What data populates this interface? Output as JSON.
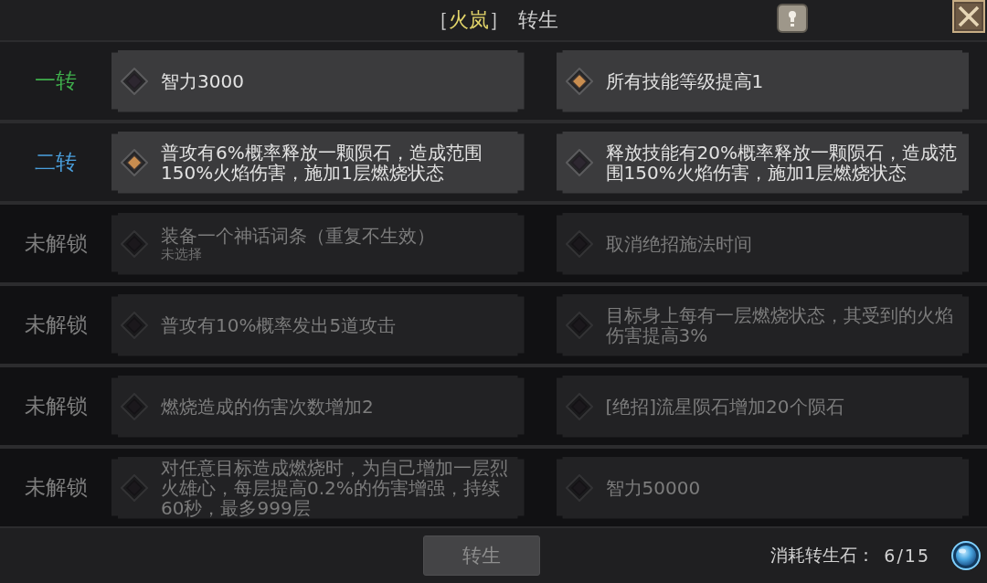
{
  "window": {
    "title": {
      "open": "［",
      "name": "火岚",
      "close": "］",
      "label": "转生"
    }
  },
  "rows": [
    {
      "label": "一转",
      "color": "#3fae4c",
      "locked": false,
      "options": [
        {
          "text": "智力3000",
          "selected": false
        },
        {
          "text": "所有技能等级提高1",
          "selected": true
        }
      ]
    },
    {
      "label": "二转",
      "color": "#4a9fdc",
      "locked": false,
      "options": [
        {
          "text": "普攻有6%概率释放一颗陨石，造成范围150%火焰伤害，施加1层燃烧状态",
          "selected": true
        },
        {
          "text": "释放技能有20%概率释放一颗陨石，造成范围150%火焰伤害，施加1层燃烧状态",
          "selected": false
        }
      ]
    },
    {
      "label": "未解锁",
      "color": "#7e7e7e",
      "locked": true,
      "options": [
        {
          "text": "装备一个神话词条（重复不生效）",
          "note": "未选择",
          "selected": false
        },
        {
          "text": "取消绝招施法时间",
          "selected": false
        }
      ]
    },
    {
      "label": "未解锁",
      "color": "#7e7e7e",
      "locked": true,
      "options": [
        {
          "text": "普攻有10%概率发出5道攻击",
          "selected": false
        },
        {
          "text": "目标身上每有一层燃烧状态，其受到的火焰伤害提高3%",
          "selected": false
        }
      ]
    },
    {
      "label": "未解锁",
      "color": "#7e7e7e",
      "locked": true,
      "options": [
        {
          "text": "燃烧造成的伤害次数增加2",
          "selected": false
        },
        {
          "text": "[绝招]流星陨石增加20个陨石",
          "selected": false
        }
      ]
    },
    {
      "label": "未解锁",
      "color": "#7e7e7e",
      "locked": true,
      "options": [
        {
          "text": "对任意目标造成燃烧时，为自己增加一层烈火雄心，每层提高0.2%的伤害增强，持续60秒，最多999层",
          "selected": false
        },
        {
          "text": "智力50000",
          "selected": false
        }
      ]
    }
  ],
  "footer": {
    "button": {
      "label": "转生",
      "disabled": true
    },
    "cost": {
      "label": "消耗转生石：",
      "count": "6/15"
    }
  }
}
